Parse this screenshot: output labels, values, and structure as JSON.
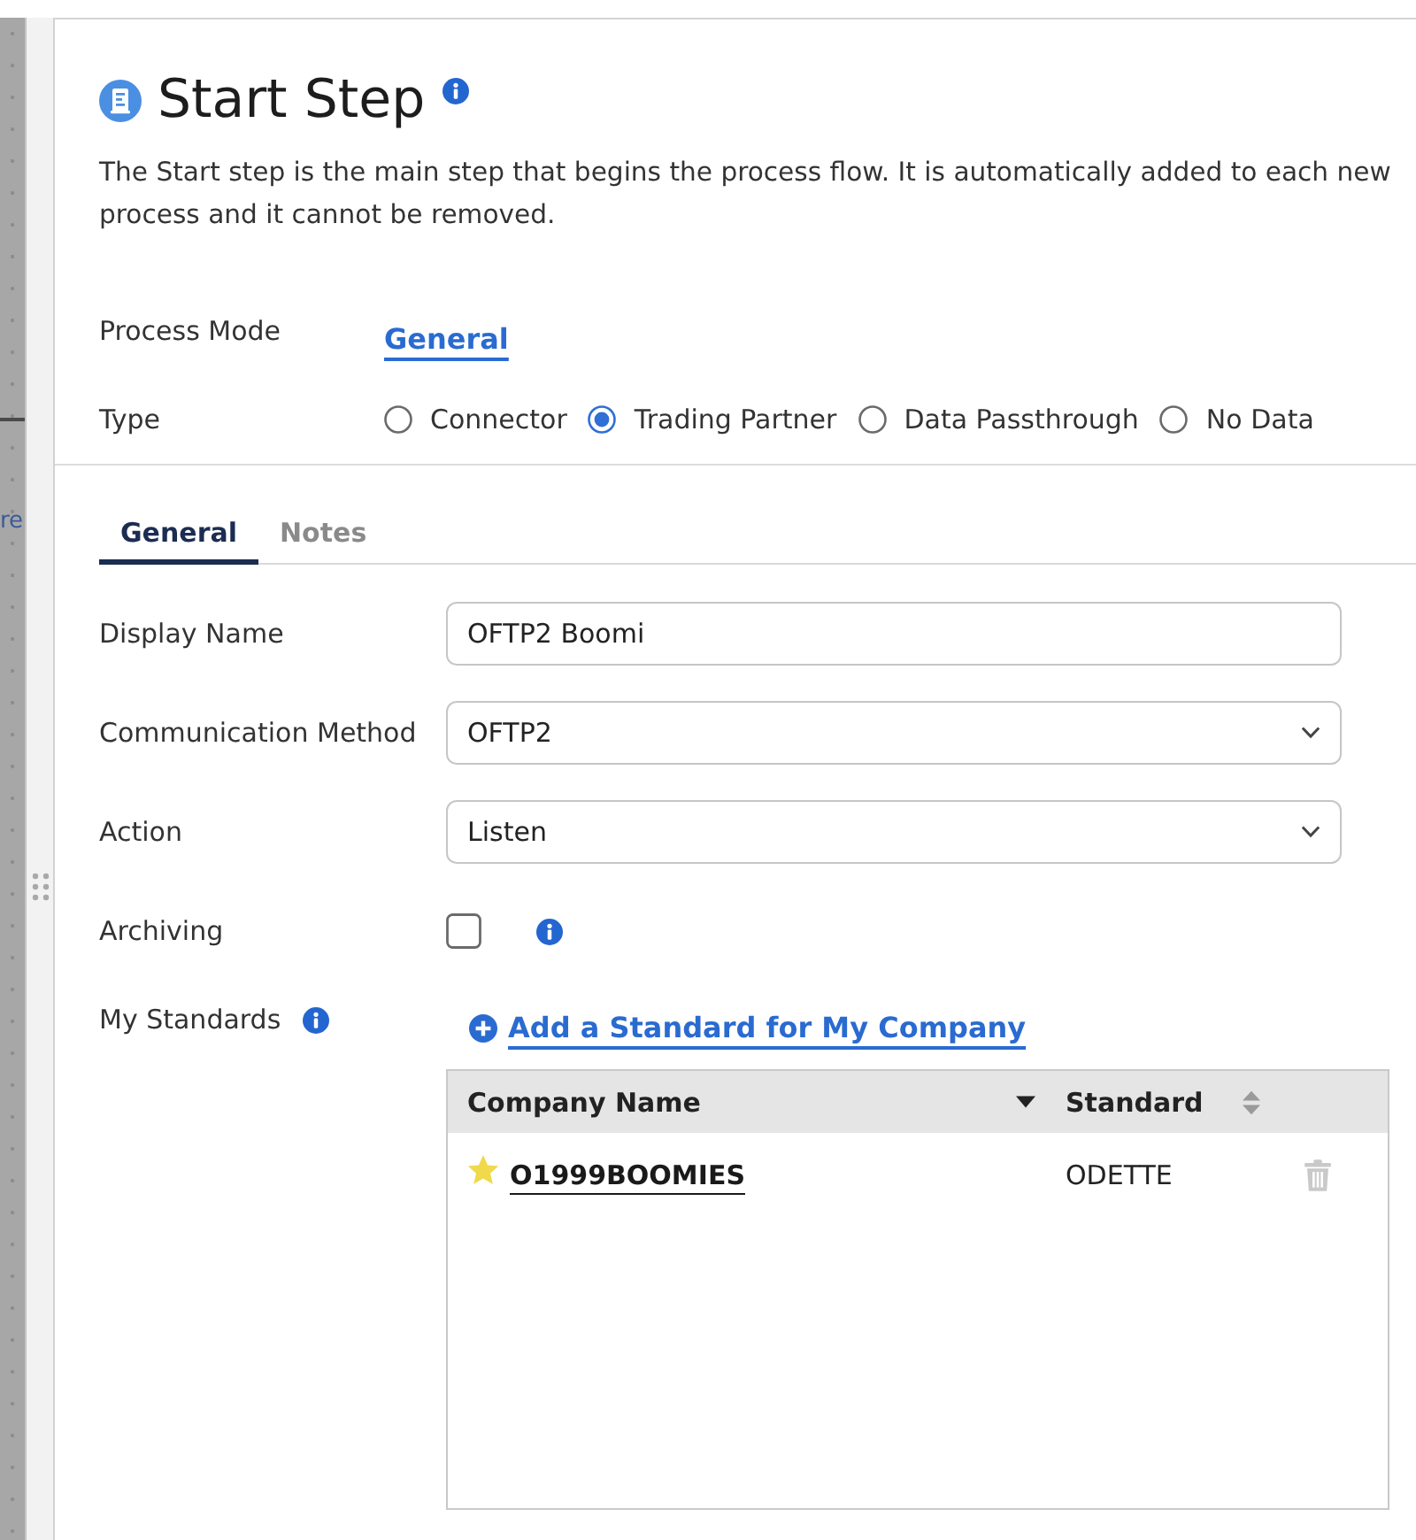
{
  "canvas": {
    "link_fragment": "re"
  },
  "header": {
    "title": "Start Step",
    "description": "The Start step is the main step that begins the process flow. It is automatically added to each new process and it cannot be removed."
  },
  "process_mode": {
    "label": "Process Mode",
    "value": "General"
  },
  "type": {
    "label": "Type",
    "options": [
      {
        "label": "Connector",
        "selected": false
      },
      {
        "label": "Trading Partner",
        "selected": true
      },
      {
        "label": "Data Passthrough",
        "selected": false
      },
      {
        "label": "No Data",
        "selected": false
      }
    ]
  },
  "tabs": [
    {
      "label": "General",
      "selected": true
    },
    {
      "label": "Notes",
      "selected": false
    }
  ],
  "fields": [
    {
      "kind": "text",
      "label": "Display Name",
      "value": "OFTP2 Boomi"
    },
    {
      "kind": "select",
      "label": "Communication Method",
      "value": "OFTP2"
    },
    {
      "kind": "select",
      "label": "Action",
      "value": "Listen"
    },
    {
      "kind": "checkbox",
      "label": "Archiving",
      "checked": false,
      "info": true
    }
  ],
  "my_standards": {
    "label": "My Standards",
    "add_link": "Add a Standard for My Company",
    "table": {
      "columns": [
        {
          "label": "Company Name",
          "sorted": true
        },
        {
          "label": "Standard",
          "sorted": false
        }
      ],
      "rows": [
        {
          "company": "O1999BOOMIES",
          "standard": "ODETTE",
          "favorite": true
        }
      ]
    }
  }
}
